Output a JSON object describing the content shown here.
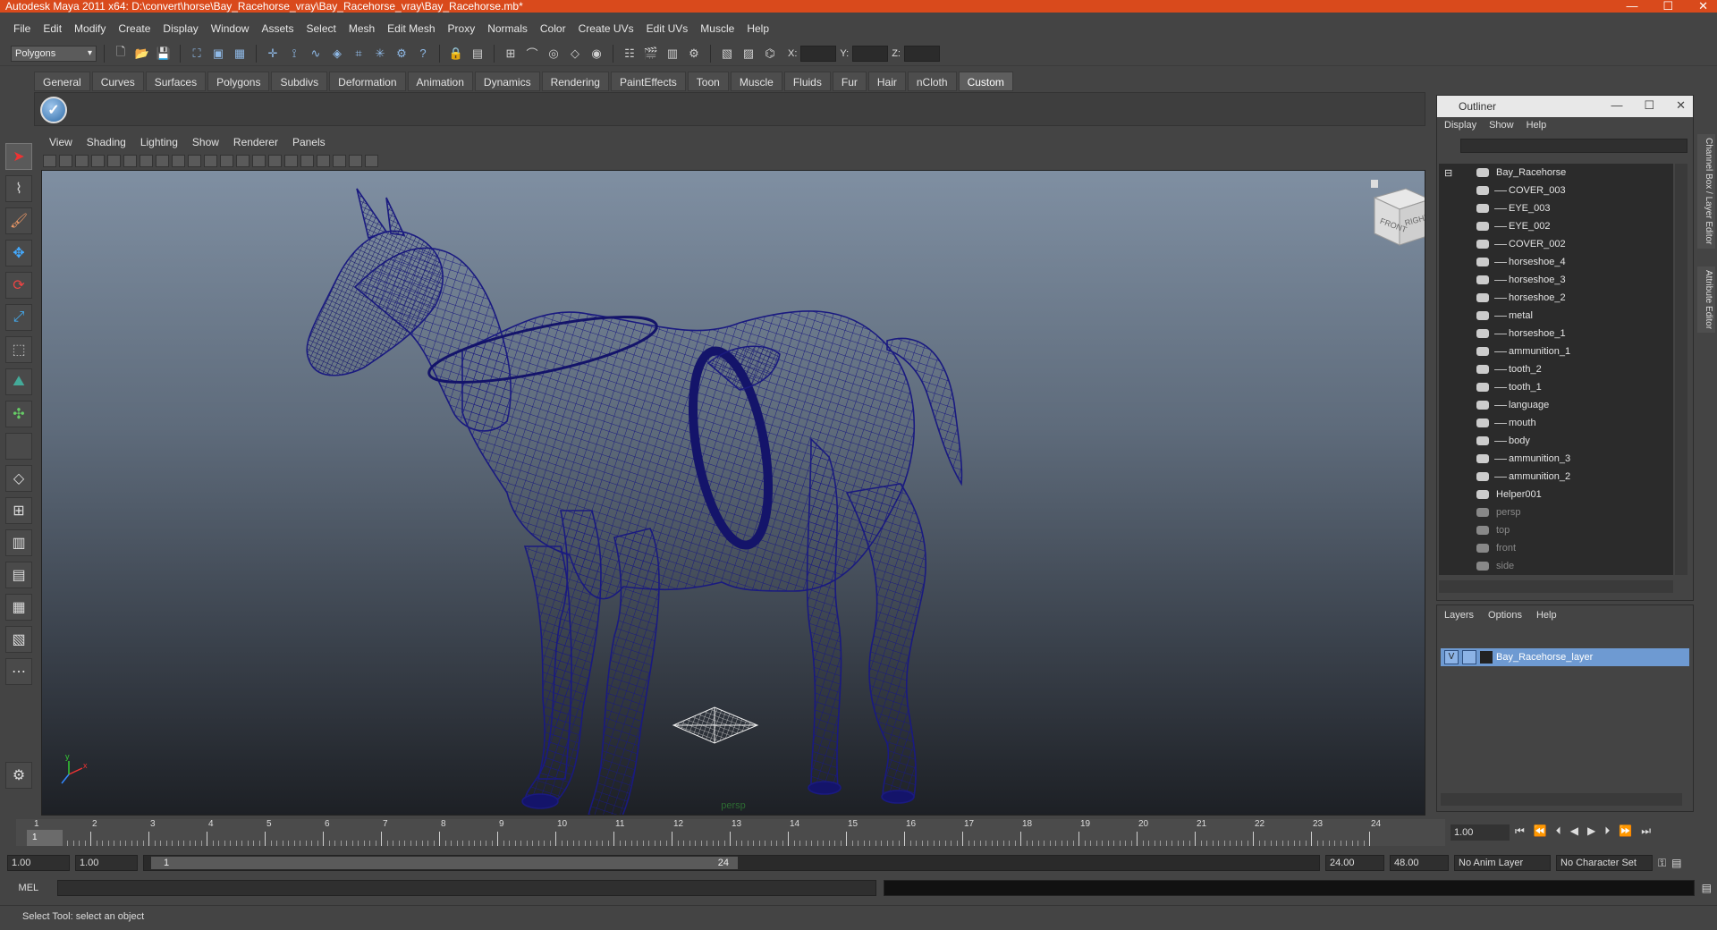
{
  "titlebar": {
    "title": "Autodesk Maya 2011 x64: D:\\convert\\horse\\Bay_Racehorse_vray\\Bay_Racehorse_vray\\Bay_Racehorse.mb*",
    "minimize": "—",
    "maximize": "☐",
    "close": "✕"
  },
  "menubar": {
    "items": [
      "File",
      "Edit",
      "Modify",
      "Create",
      "Display",
      "Window",
      "Assets",
      "Select",
      "Mesh",
      "Edit Mesh",
      "Proxy",
      "Normals",
      "Color",
      "Create UVs",
      "Edit UVs",
      "Muscle",
      "Help"
    ]
  },
  "statusline": {
    "mode": "Polygons",
    "x_label": "X:",
    "y_label": "Y:",
    "z_label": "Z:"
  },
  "shelf": {
    "tabs": [
      "General",
      "Curves",
      "Surfaces",
      "Polygons",
      "Subdivs",
      "Deformation",
      "Animation",
      "Dynamics",
      "Rendering",
      "PaintEffects",
      "Toon",
      "Muscle",
      "Fluids",
      "Fur",
      "Hair",
      "nCloth",
      "Custom"
    ],
    "active_tab": "Custom"
  },
  "viewport": {
    "menu": [
      "View",
      "Shading",
      "Lighting",
      "Show",
      "Renderer",
      "Panels"
    ],
    "camera": "persp",
    "viewcube": {
      "front": "FRONT",
      "right": "RIGHT"
    },
    "wire_color": "#1a1a80",
    "axis": {
      "x": "x",
      "y": "y"
    }
  },
  "outliner": {
    "title": "Outliner",
    "menu": [
      "Display",
      "Show",
      "Help"
    ],
    "items": [
      {
        "label": "Bay_Racehorse",
        "dim": false
      },
      {
        "label": "COVER_003",
        "dim": false
      },
      {
        "label": "EYE_003",
        "dim": false
      },
      {
        "label": "EYE_002",
        "dim": false
      },
      {
        "label": "COVER_002",
        "dim": false
      },
      {
        "label": "horseshoe_4",
        "dim": false
      },
      {
        "label": "horseshoe_3",
        "dim": false
      },
      {
        "label": "horseshoe_2",
        "dim": false
      },
      {
        "label": "metal",
        "dim": false
      },
      {
        "label": "horseshoe_1",
        "dim": false
      },
      {
        "label": "ammunition_1",
        "dim": false
      },
      {
        "label": "tooth_2",
        "dim": false
      },
      {
        "label": "tooth_1",
        "dim": false
      },
      {
        "label": "language",
        "dim": false
      },
      {
        "label": "mouth",
        "dim": false
      },
      {
        "label": "body",
        "dim": false
      },
      {
        "label": "ammunition_3",
        "dim": false
      },
      {
        "label": "ammunition_2",
        "dim": false
      },
      {
        "label": "Helper001",
        "dim": false
      },
      {
        "label": "persp",
        "dim": true
      },
      {
        "label": "top",
        "dim": true
      },
      {
        "label": "front",
        "dim": true
      },
      {
        "label": "side",
        "dim": true
      }
    ]
  },
  "layers": {
    "menu": [
      "Layers",
      "Options",
      "Help"
    ],
    "layer_name": "Bay_Racehorse_layer",
    "visible_flag": "V",
    "selection_color": "#6e9ad2"
  },
  "side_tabs": [
    "Channel Box / Layer Editor",
    "Attribute Editor"
  ],
  "timeline": {
    "ticks": [
      "1",
      "2",
      "3",
      "4",
      "5",
      "6",
      "7",
      "8",
      "9",
      "10",
      "11",
      "12",
      "13",
      "14",
      "15",
      "16",
      "17",
      "18",
      "19",
      "20",
      "21",
      "22",
      "23",
      "24"
    ],
    "current_frame": "1.00",
    "current_marker": "1"
  },
  "range": {
    "start": "1.00",
    "anim_start": "1.00",
    "slider_start": "1",
    "slider_end": "24",
    "end": "24.00",
    "anim_end": "48.00",
    "anim_layer": "No Anim Layer",
    "character_set": "No Character Set"
  },
  "commandline": {
    "label": "MEL",
    "value": ""
  },
  "helpline": {
    "text": "Select Tool: select an object"
  }
}
